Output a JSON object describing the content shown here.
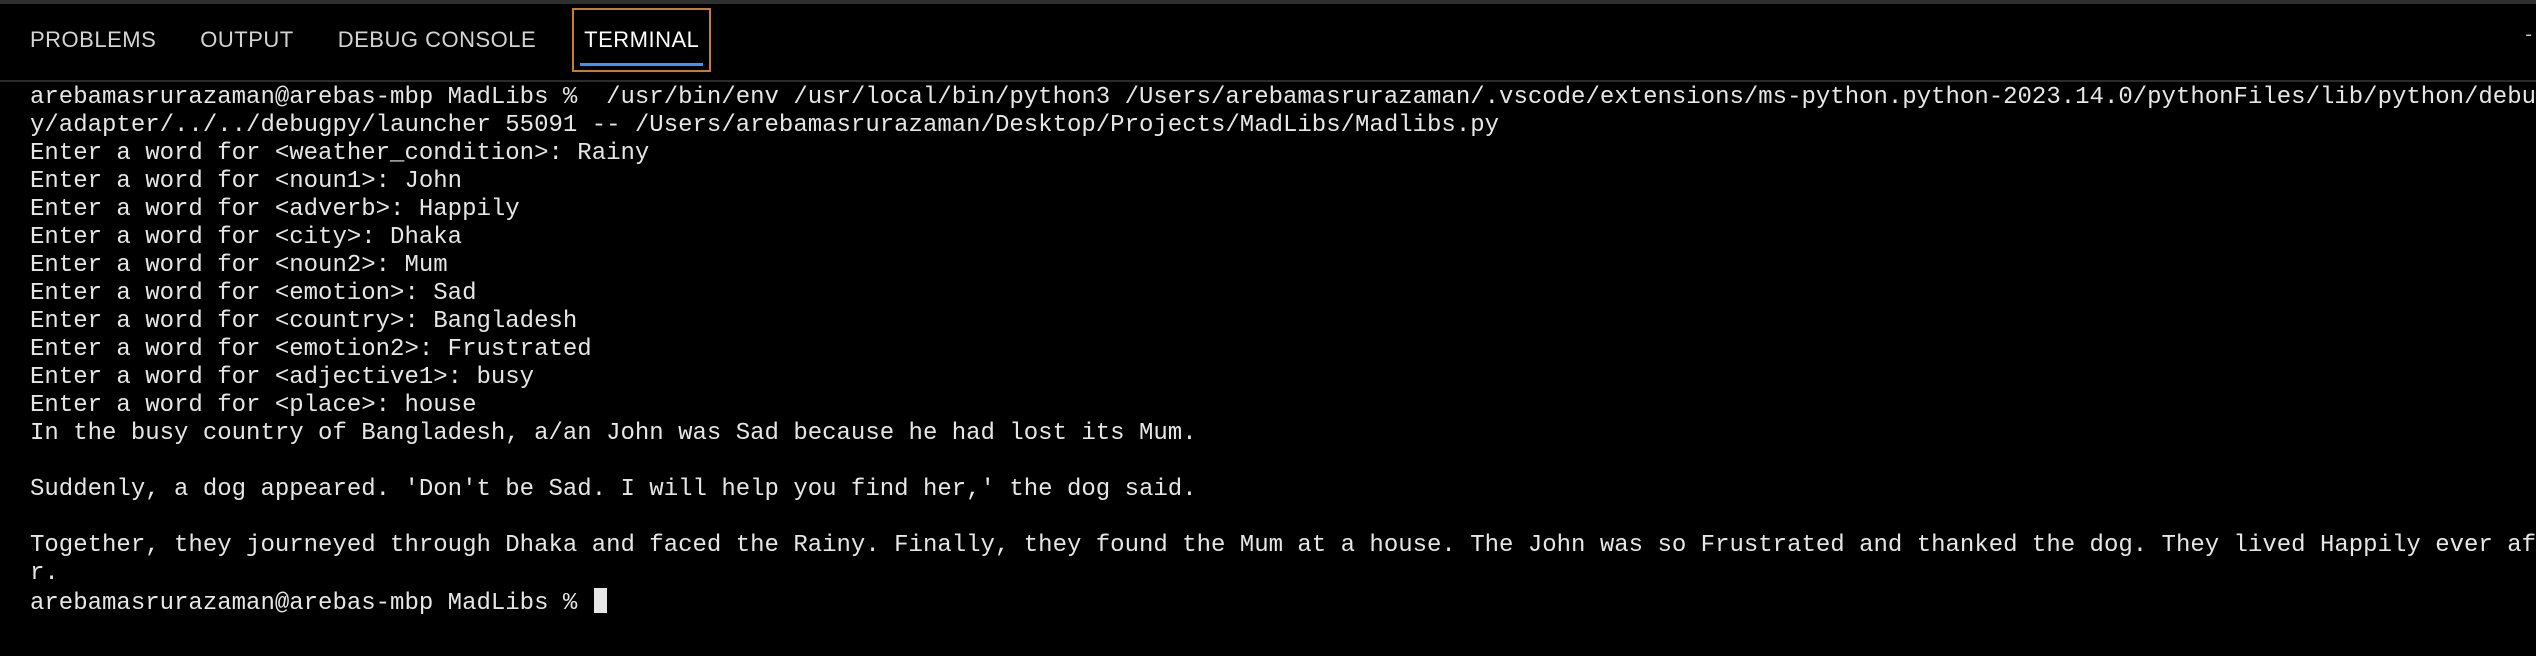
{
  "panel": {
    "tabs": [
      {
        "label": "PROBLEMS"
      },
      {
        "label": "OUTPUT"
      },
      {
        "label": "DEBUG CONSOLE"
      },
      {
        "label": "TERMINAL"
      }
    ],
    "active_tab": "TERMINAL",
    "corner_glyph": "-"
  },
  "terminal": {
    "lines": [
      "arebamasrurazaman@arebas-mbp MadLibs %  /usr/bin/env /usr/local/bin/python3 /Users/arebamasrurazaman/.vscode/extensions/ms-python.python-2023.14.0/pythonFiles/lib/python/debugp",
      "y/adapter/../../debugpy/launcher 55091 -- /Users/arebamasrurazaman/Desktop/Projects/MadLibs/Madlibs.py",
      "Enter a word for <weather_condition>: Rainy",
      "Enter a word for <noun1>: John",
      "Enter a word for <adverb>: Happily",
      "Enter a word for <city>: Dhaka",
      "Enter a word for <noun2>: Mum",
      "Enter a word for <emotion>: Sad",
      "Enter a word for <country>: Bangladesh",
      "Enter a word for <emotion2>: Frustrated",
      "Enter a word for <adjective1>: busy",
      "Enter a word for <place>: house",
      "In the busy country of Bangladesh, a/an John was Sad because he had lost its Mum.",
      "",
      "Suddenly, a dog appeared. 'Don't be Sad. I will help you find her,' the dog said.",
      "",
      "Together, they journeyed through Dhaka and faced the Rainy. Finally, they found the Mum at a house. The John was so Frustrated and thanked the dog. They lived Happily ever afte",
      "r."
    ],
    "prompt": "arebamasrurazaman@arebas-mbp MadLibs % "
  },
  "colors": {
    "background": "#000000",
    "text": "#e6e6e6",
    "active_tab_border": "#c67d2f",
    "active_tab_underline": "#3794ff"
  }
}
